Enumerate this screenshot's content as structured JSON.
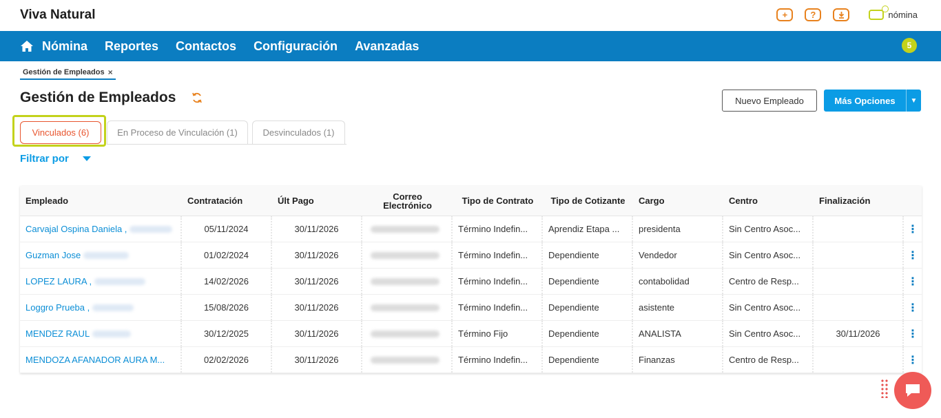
{
  "header": {
    "brand": "Viva Natural",
    "icons": [
      "plus-icon",
      "help-icon",
      "download-icon"
    ],
    "module_label": "nómina"
  },
  "nav": {
    "items": [
      "Nómina",
      "Reportes",
      "Contactos",
      "Configuración",
      "Avanzadas"
    ],
    "notification_count": "5"
  },
  "breadcrumb": {
    "label": "Gestión de Empleados",
    "close": "×"
  },
  "page": {
    "title": "Gestión de Empleados",
    "new_button": "Nuevo Empleado",
    "more_button": "Más Opciones"
  },
  "tabs": [
    {
      "label": "Vinculados (6)",
      "active": true
    },
    {
      "label": "En Proceso de Vinculación (1)",
      "active": false
    },
    {
      "label": "Desvinculados (1)",
      "active": false
    }
  ],
  "filter": {
    "label": "Filtrar por"
  },
  "table": {
    "headers": [
      "Empleado",
      "Contratación",
      "Últ Pago",
      "Correo Electrónico",
      "Tipo de Contrato",
      "Tipo de Cotizante",
      "Cargo",
      "Centro",
      "Finalización"
    ],
    "rows": [
      {
        "empleado": "Carvajal Ospina Daniela ,",
        "contratacion": "05/11/2024",
        "ult_pago": "30/11/2026",
        "tipo_contrato": "Término Indefin...",
        "tipo_cotizante": "Aprendiz Etapa ...",
        "cargo": "presidenta",
        "centro": "Sin Centro Asoc...",
        "finalizacion": ""
      },
      {
        "empleado": "Guzman Jose",
        "contratacion": "01/02/2024",
        "ult_pago": "30/11/2026",
        "tipo_contrato": "Término Indefin...",
        "tipo_cotizante": "Dependiente",
        "cargo": "Vendedor",
        "centro": "Sin Centro Asoc...",
        "finalizacion": ""
      },
      {
        "empleado": "LOPEZ LAURA ,",
        "contratacion": "14/02/2026",
        "ult_pago": "30/11/2026",
        "tipo_contrato": "Término Indefin...",
        "tipo_cotizante": "Dependiente",
        "cargo": "contabolidad",
        "centro": "Centro de Resp...",
        "finalizacion": ""
      },
      {
        "empleado": "Loggro Prueba ,",
        "contratacion": "15/08/2026",
        "ult_pago": "30/11/2026",
        "tipo_contrato": "Término Indefin...",
        "tipo_cotizante": "Dependiente",
        "cargo": "asistente",
        "centro": "Sin Centro Asoc...",
        "finalizacion": ""
      },
      {
        "empleado": "MENDEZ RAUL",
        "contratacion": "30/12/2025",
        "ult_pago": "30/11/2026",
        "tipo_contrato": "Término Fijo",
        "tipo_cotizante": "Dependiente",
        "cargo": "ANALISTA",
        "centro": "Sin Centro Asoc...",
        "finalizacion": "30/11/2026"
      },
      {
        "empleado": "MENDOZA AFANADOR AURA M...",
        "contratacion": "02/02/2026",
        "ult_pago": "30/11/2026",
        "tipo_contrato": "Término Indefin...",
        "tipo_cotizante": "Dependiente",
        "cargo": "Finanzas",
        "centro": "Centro de Resp...",
        "finalizacion": ""
      }
    ],
    "row_menu_glyph": "⋮"
  },
  "colors": {
    "primary": "#0b7dc1",
    "accent_orange": "#e8821e",
    "accent_lime": "#c3d21b",
    "tab_active": "#e8552e",
    "button_blue": "#0b9ce5",
    "chat": "#ef5a57"
  }
}
